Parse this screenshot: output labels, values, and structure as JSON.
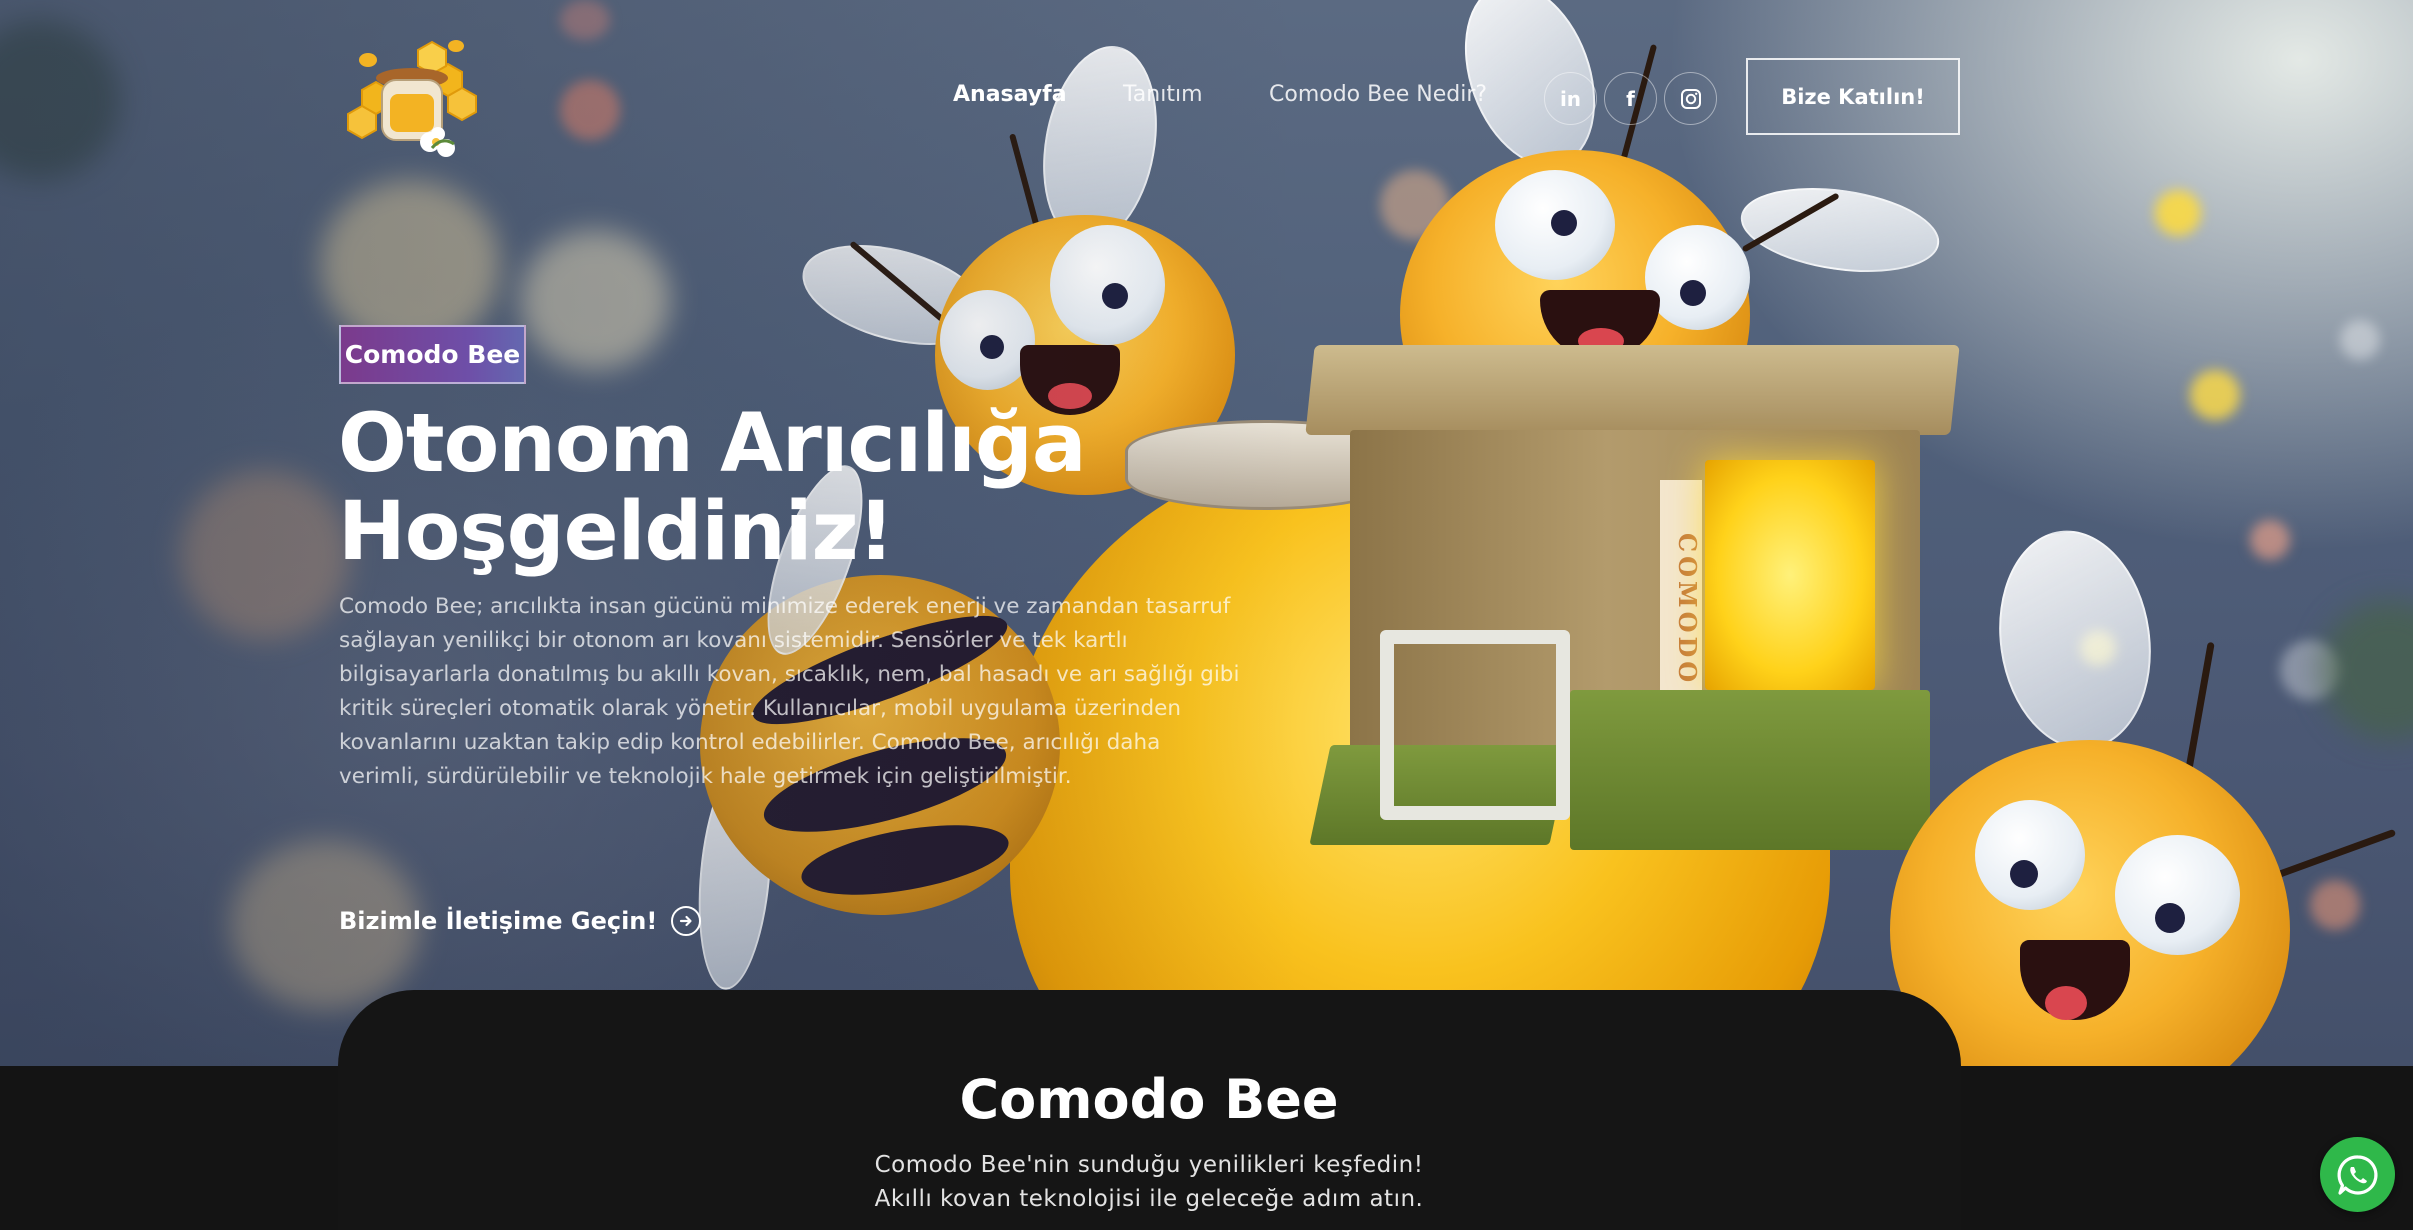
{
  "header": {
    "logo_alt": "Comodo Bee logo",
    "nav": [
      {
        "label": "Anasayfa",
        "active": true
      },
      {
        "label": "Tanıtım",
        "active": false
      },
      {
        "label": "Comodo Bee Nedir?",
        "active": false
      }
    ],
    "social": [
      {
        "icon": "linkedin-icon",
        "glyph": "in"
      },
      {
        "icon": "facebook-icon",
        "glyph": "f"
      },
      {
        "icon": "instagram-icon",
        "glyph": ""
      }
    ],
    "join_button": "Bize Katılın!"
  },
  "hero": {
    "badge": "Comodo Bee",
    "title_line1": "Otonom Arıcılığa",
    "title_line2": "Hoşgeldiniz!",
    "description": "Comodo Bee; arıcılıkta insan gücünü minimize ederek enerji ve zamandan tasarruf sağlayan yenilikçi bir otonom arı kovanı sistemidir. Sensörler ve tek kartlı bilgisayarlarla donatılmış bu akıllı kovan, sıcaklık, nem, bal hasadı ve arı sağlığı gibi kritik süreçleri otomatik olarak yönetir. Kullanıcılar, mobil uygulama üzerinden kovanlarını uzaktan takip edip kontrol edebilirler. Comodo Bee, arıcılığı daha verimli, sürdürülebilir ve teknolojik hale getirmek için geliştirilmiştir.",
    "contact_link": "Bizimle İletişime Geçin!",
    "hive_label": "COMODO"
  },
  "section": {
    "title": "Comodo Bee",
    "subtitle_line1": "Comodo Bee'nin sunduğu yenilikleri keşfedin!",
    "subtitle_line2": "Akıllı kovan teknolojisi ile geleceğe adım atın."
  },
  "colors": {
    "badge_gradient_start": "#7b3a8c",
    "badge_gradient_end": "#6468b0",
    "dark_section": "#151515",
    "whatsapp": "#2fb84a"
  }
}
